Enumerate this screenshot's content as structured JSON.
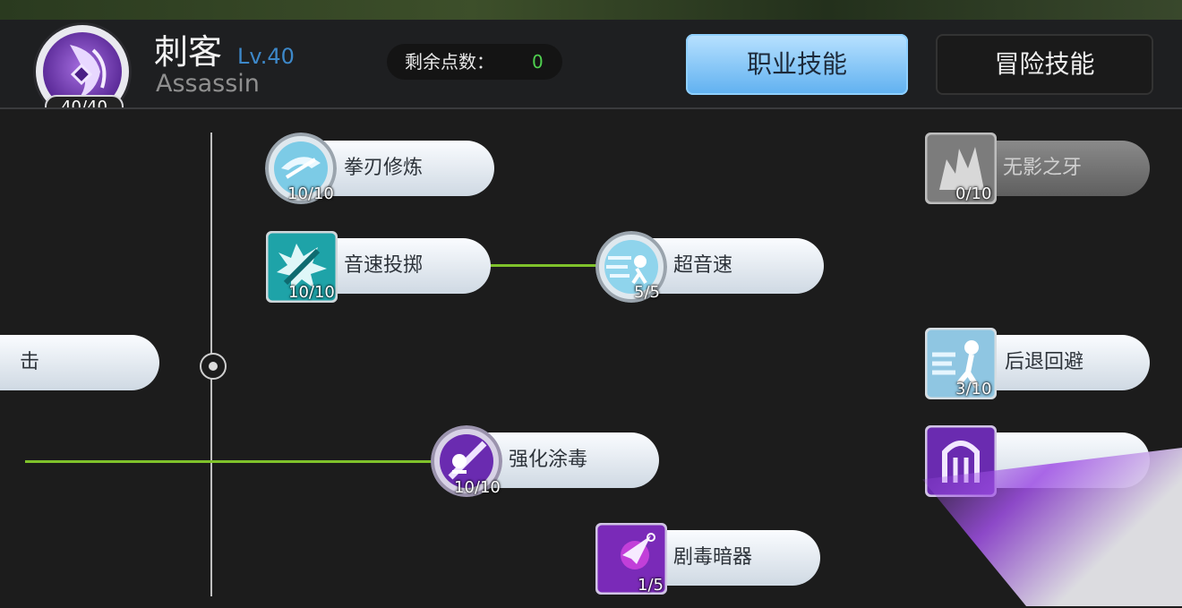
{
  "header": {
    "class_name": "刺客",
    "level": "Lv.40",
    "class_name_en": "Assassin",
    "hp": "40/40",
    "points_label": "剩余点数：",
    "points_value": "0"
  },
  "tabs": [
    {
      "label": "职业技能",
      "active": true
    },
    {
      "label": "冒险技能",
      "active": false
    }
  ],
  "skills": [
    {
      "id": "fist_blade",
      "name": "拳刃修炼",
      "level": "10/10",
      "icon": "blade-training-icon"
    },
    {
      "id": "sonic_throw",
      "name": "音速投掷",
      "level": "10/10",
      "icon": "sonic-throw-icon"
    },
    {
      "id": "supersonic",
      "name": "超音速",
      "level": "5/5",
      "icon": "supersonic-icon"
    },
    {
      "id": "shadow_fang",
      "name": "无影之牙",
      "level": "0/10",
      "icon": "shadow-fang-icon"
    },
    {
      "id": "back_dodge",
      "name": "后退回避",
      "level": "3/10",
      "icon": "back-dodge-icon"
    },
    {
      "id": "enhance_poison",
      "name": "强化涂毒",
      "level": "10/10",
      "icon": "poison-blade-icon"
    },
    {
      "id": "venom_hidden",
      "name": "剧毒暗器",
      "level": "1/5",
      "icon": "venom-dart-icon"
    },
    {
      "id": "partial_left",
      "name": "击",
      "icon": ""
    }
  ],
  "colors": {
    "accent_blue": "#5fb0f0",
    "link_green": "#7fc22b",
    "level_blue": "#3d88c9",
    "points_green": "#4fd04f"
  }
}
